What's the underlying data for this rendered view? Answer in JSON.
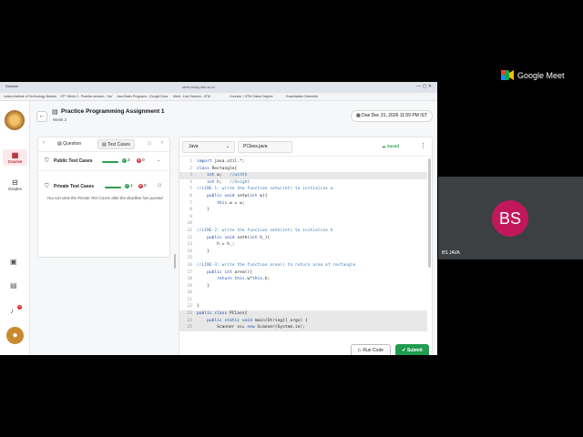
{
  "browser": {
    "tab_name": "Session",
    "url": "seek.study.iitm.ac.in",
    "bookmarks": [
      "Indian Institute of Technology Madras · Ca...",
      "OTT Week 2 - Practice session - YouTube",
      "Java Basic Programs - Google Docs",
      "Meet - Live Session - IITM",
      "Courses + IITM Online Degree",
      "Examination Schedule"
    ]
  },
  "rail": {
    "course_label": "Course",
    "grades_label": "Grades",
    "notification_count": "3",
    "avatar_initial": "●"
  },
  "header": {
    "title": "Practice Programming Assignment 1",
    "week": "Week 2",
    "due": "Due Dec 31, 2026  11:59 PM IST"
  },
  "tabs": {
    "question": "Question",
    "test_cases": "Test Cases"
  },
  "test_cases": {
    "public": {
      "label": "Public Test Cases",
      "passed": "2",
      "failed": "0"
    },
    "private": {
      "label": "Private Test Cases",
      "passed": "1",
      "failed": "0"
    },
    "private_note": "You can view the Private Test Cases after the deadline has passed"
  },
  "editor": {
    "language": "Java",
    "filename": "PClass.java",
    "status": "Saved",
    "run_label": "Run Code",
    "submit_label": "Submit",
    "lines": [
      "import java.util.*;",
      "class Rectangle{",
      "    int w;   //width",
      "    int h;   //height",
      "  //LINE-1: write the function setw(int) to initialize w",
      "    public void setw(int w){",
      "        this.w = w;",
      "    }",
      "",
      "",
      "  //LINE-2: write the function seth(int) to initialize h",
      "    public void seth(int h_){",
      "        h = h_;",
      "    }",
      "",
      "  //LINE-3: write the function area() to return area of rectangle",
      "    public int area(){",
      "        return this.w*this.h;",
      "    }",
      "",
      "",
      "}",
      "public class PClass{",
      "    public static void main(String[] args) {",
      "        Scanner sc= new Scanner(System.in);"
    ]
  },
  "meet": {
    "brand": "Google Meet",
    "participant_initials": "BS",
    "participant_name": "BS JAVA"
  },
  "colors": {
    "accent_red": "#b3262d",
    "pass_green": "#2e9e4f",
    "submit_green": "#1f9c4e",
    "meet_avatar": "#c2185b"
  }
}
